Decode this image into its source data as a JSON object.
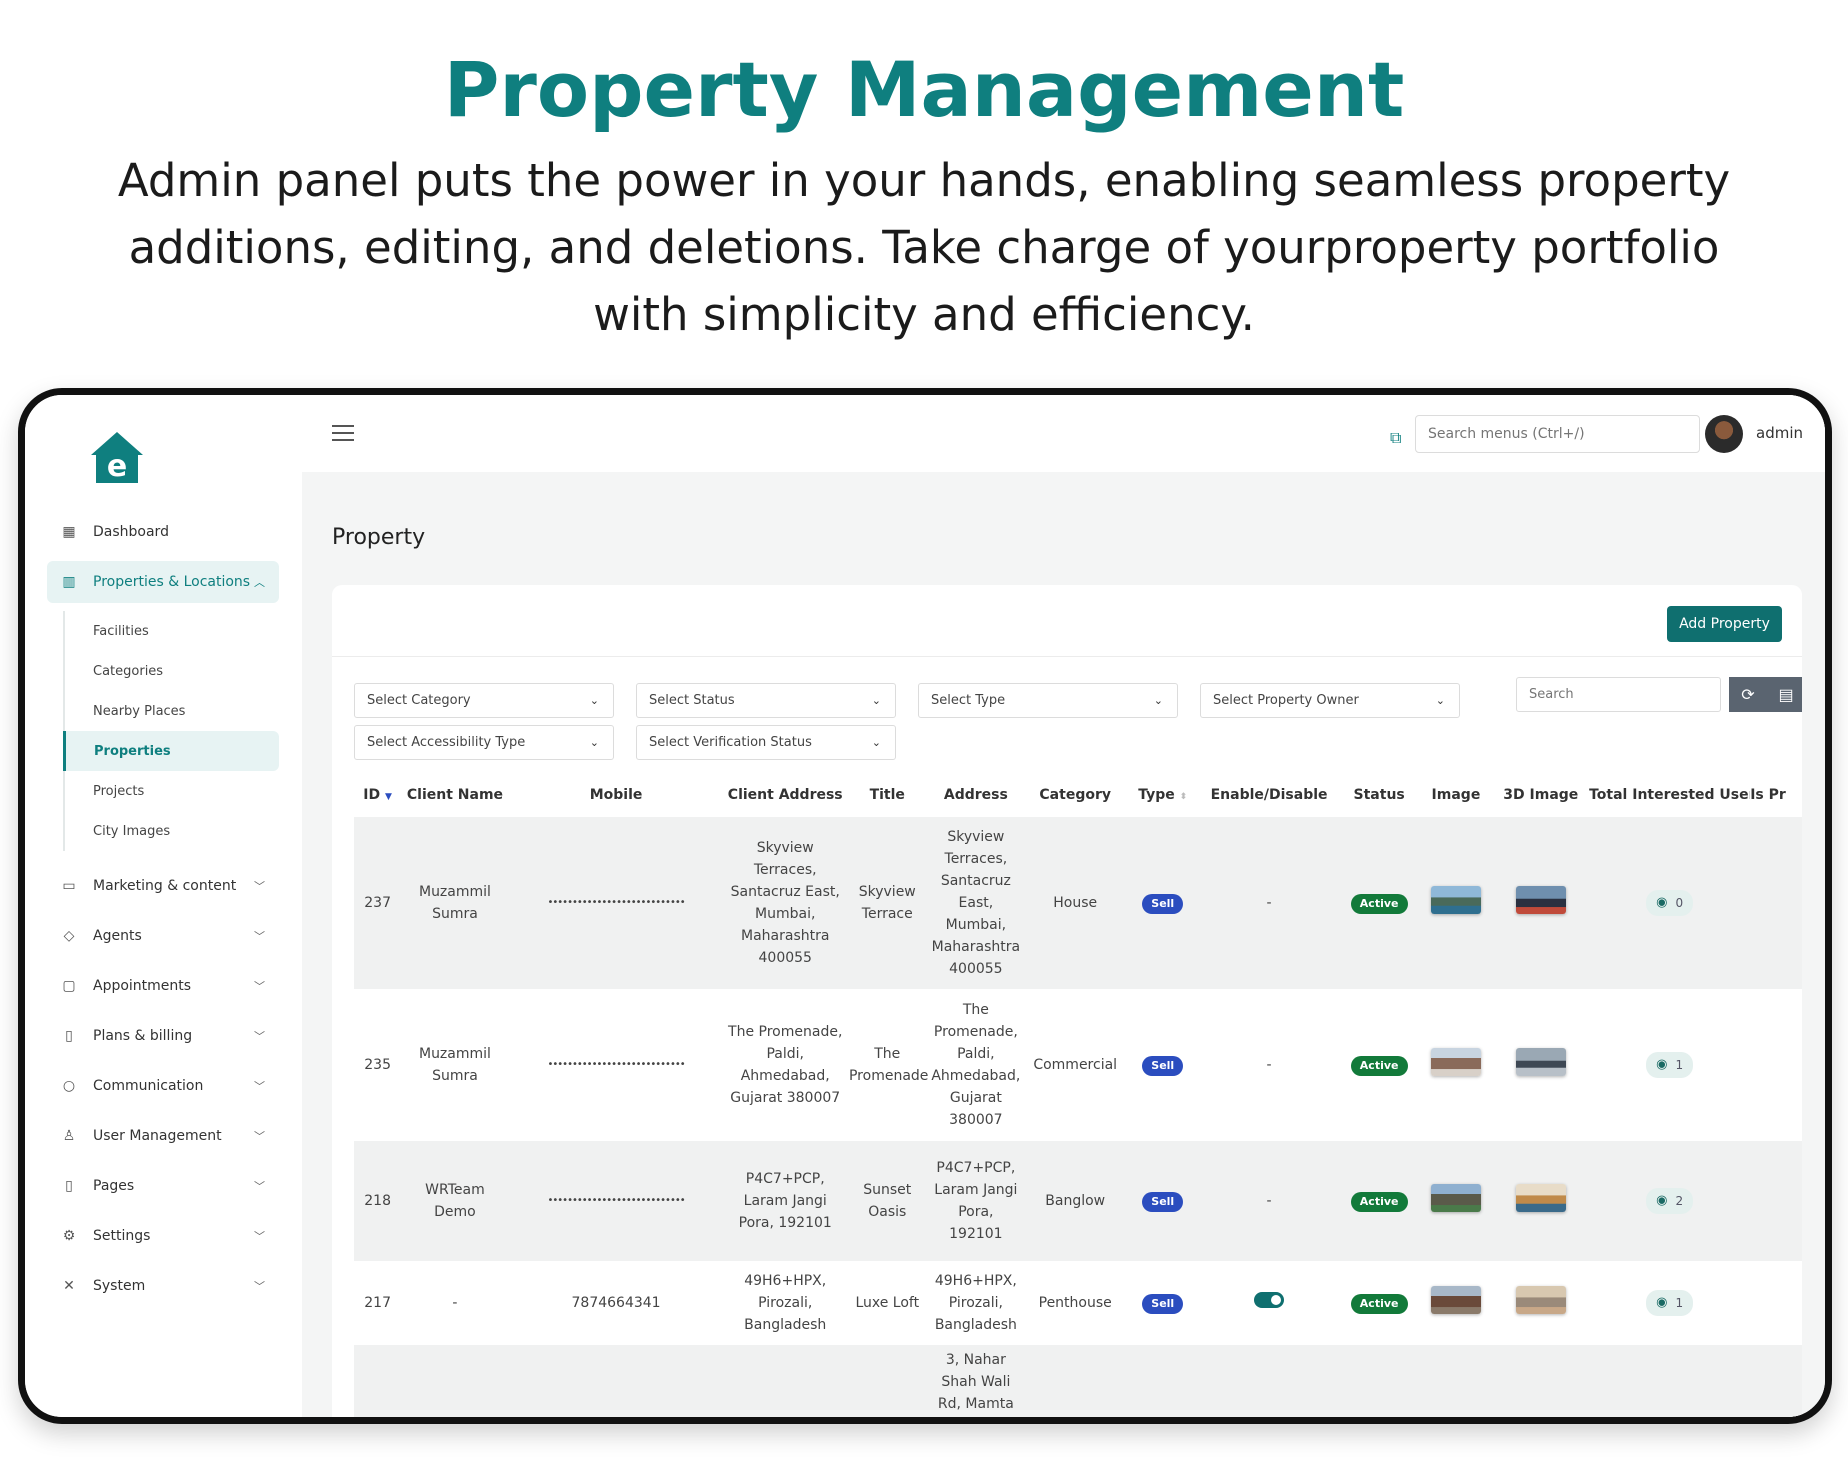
{
  "hero": {
    "title": "Property Management",
    "subtitle": "Admin panel puts the power in your hands, enabling seamless property additions, editing, and deletions. Take charge of yourproperty portfolio with simplicity and efficiency."
  },
  "colors": {
    "accent": "#0f7f7f",
    "sell": "#2b4dbf",
    "active": "#127a3a"
  },
  "topbar": {
    "search_placeholder": "Search menus (Ctrl+/)",
    "user": "admin"
  },
  "sidebar": {
    "items": [
      {
        "label": "Dashboard",
        "icon": "grid-icon"
      },
      {
        "label": "Properties & Locations",
        "icon": "building-icon"
      },
      {
        "label": "Marketing & content",
        "icon": "ad-icon"
      },
      {
        "label": "Agents",
        "icon": "shield-icon"
      },
      {
        "label": "Appointments",
        "icon": "calendar-icon"
      },
      {
        "label": "Plans & billing",
        "icon": "invoice-icon"
      },
      {
        "label": "Communication",
        "icon": "chat-icon"
      },
      {
        "label": "User Management",
        "icon": "user-icon"
      },
      {
        "label": "Pages",
        "icon": "page-icon"
      },
      {
        "label": "Settings",
        "icon": "gear-icon"
      },
      {
        "label": "System",
        "icon": "tools-icon"
      }
    ],
    "sub_items": [
      "Facilities",
      "Categories",
      "Nearby Places",
      "Properties",
      "Projects",
      "City Images"
    ]
  },
  "page": {
    "title": "Property",
    "add_button": "Add Property"
  },
  "filters": {
    "category": "Select Category",
    "status": "Select Status",
    "type": "Select Type",
    "owner": "Select Property Owner",
    "accessibility": "Select Accessibility Type",
    "verification": "Select Verification Status",
    "search_placeholder": "Search"
  },
  "table": {
    "headers": [
      "ID",
      "Client Name",
      "Mobile",
      "Client Address",
      "Title",
      "Address",
      "Category",
      "Type",
      "Enable/Disable",
      "Status",
      "Image",
      "3D Image",
      "Total Interested Users",
      "Is Pr"
    ],
    "rows": [
      {
        "id": "237",
        "client": "Muzammil Sumra",
        "mobile": "••••••••••••••••••••••••••••",
        "client_address": "Skyview Terraces, Santacruz East, Mumbai, Maharashtra 400055",
        "title": "Skyview Terrace",
        "address": "Skyview Terraces, Santacruz East, Mumbai, Maharashtra 400055",
        "category": "House",
        "type": "Sell",
        "enable": "-",
        "status": "Active",
        "interested": "0"
      },
      {
        "id": "235",
        "client": "Muzammil Sumra",
        "mobile": "••••••••••••••••••••••••••••",
        "client_address": "The Promenade, Paldi, Ahmedabad, Gujarat 380007",
        "title": "The Promenade",
        "address": "The Promenade, Paldi, Ahmedabad, Gujarat 380007",
        "category": "Commercial",
        "type": "Sell",
        "enable": "-",
        "status": "Active",
        "interested": "1"
      },
      {
        "id": "218",
        "client": "WRTeam Demo",
        "mobile": "••••••••••••••••••••••••••••",
        "client_address": "P4C7+PCP, Laram Jangi Pora, 192101",
        "title": "Sunset Oasis",
        "address": "P4C7+PCP, Laram Jangi Pora, 192101",
        "category": "Banglow",
        "type": "Sell",
        "enable": "-",
        "status": "Active",
        "interested": "2"
      },
      {
        "id": "217",
        "client": "-",
        "mobile": "7874664341",
        "client_address": "49H6+HPX, Pirozali, Bangladesh",
        "title": "Luxe Loft",
        "address": "49H6+HPX, Pirozali, Bangladesh",
        "category": "Penthouse",
        "type": "Sell",
        "enable": "toggle",
        "status": "Active",
        "interested": "1"
      },
      {
        "id": "",
        "client": "",
        "mobile": "",
        "client_address": "3, Nahar Shah",
        "title": "",
        "address": "3, Nahar Shah Wali Rd, Mamta",
        "category": "",
        "type": "",
        "enable": "",
        "status": "",
        "interested": ""
      }
    ]
  }
}
